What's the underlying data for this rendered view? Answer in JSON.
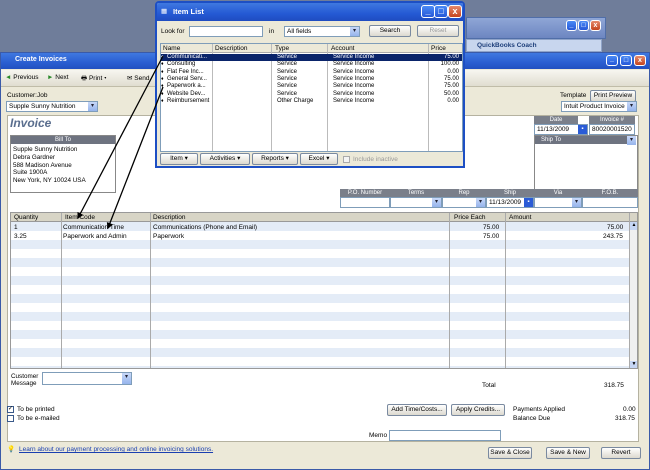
{
  "coach": {
    "title": "QuickBooks Coach"
  },
  "invoice_window": {
    "title": "Create Invoices",
    "toolbar": [
      "Previous",
      "Next",
      "Print",
      "Send"
    ],
    "customer_label": "Customer:Job",
    "customer_value": "Supple Sunny Nutrition",
    "template_label": "Template",
    "print_preview": "Print Preview",
    "template_value": "Intuit Product Invoice",
    "heading": "Invoice",
    "date_label": "Date",
    "date_value": "11/13/2009",
    "invoice_no_label": "Invoice #",
    "invoice_no_value": "80020001520",
    "bill_to_label": "Bill To",
    "bill_to_lines": [
      "Supple Sunny Nutrition",
      "Debra Gardner",
      "588 Madison Avenue",
      "Suite 1900A",
      "New York, NY 10024 USA"
    ],
    "ship_to_label": "Ship To",
    "fields": {
      "po": "P.O. Number",
      "terms": "Terms",
      "rep": "Rep",
      "ship": "Ship",
      "ship_value": "11/13/2009",
      "via": "Via",
      "fob": "F.O.B."
    },
    "columns": {
      "qty": "Quantity",
      "code": "Item Code",
      "desc": "Description",
      "price": "Price Each",
      "amount": "Amount"
    },
    "rows": [
      {
        "qty": "1",
        "code": "Communication Time",
        "desc": "Communications (Phone and Email)",
        "price": "75.00",
        "amount": "75.00"
      },
      {
        "qty": "3.25",
        "code": "Paperwork and Admin",
        "desc": "Paperwork",
        "price": "75.00",
        "amount": "243.75"
      }
    ],
    "customer_message_label": "Customer Message",
    "total_label": "Total",
    "total_value": "318.75",
    "to_be_printed": "To be printed",
    "to_be_emailed": "To be e-mailed",
    "add_time": "Add Time/Costs...",
    "apply_credits": "Apply Credits...",
    "payments_applied_label": "Payments Applied",
    "payments_applied_value": "0.00",
    "balance_due_label": "Balance Due",
    "balance_due_value": "318.75",
    "learn_link": "Learn about our payment processing and online invoicing solutions.",
    "memo_label": "Memo",
    "save_close": "Save & Close",
    "save_new": "Save & New",
    "revert": "Revert"
  },
  "item_list": {
    "title": "Item List",
    "look_for": "Look for",
    "in_label": "in",
    "in_value": "All fields",
    "search": "Search",
    "reset": "Reset",
    "columns": [
      "Name",
      "Description",
      "Type",
      "Account",
      "Price"
    ],
    "rows": [
      {
        "name": "Communicati...",
        "type": "Service",
        "account": "Service Income",
        "price": "75.00"
      },
      {
        "name": "Consulting",
        "type": "Service",
        "account": "Service Income",
        "price": "100.00"
      },
      {
        "name": "Flat Fee Inc...",
        "type": "Service",
        "account": "Service Income",
        "price": "0.00"
      },
      {
        "name": "General Serv...",
        "type": "Service",
        "account": "Service Income",
        "price": "75.00"
      },
      {
        "name": "Paperwork a...",
        "type": "Service",
        "account": "Service Income",
        "price": "75.00"
      },
      {
        "name": "Website Dev...",
        "type": "Service",
        "account": "Service Income",
        "price": "50.00"
      },
      {
        "name": "Reimbursement",
        "type": "Other Charge",
        "account": "Service Income",
        "price": "0.00"
      }
    ],
    "footer": [
      "Item",
      "Activities",
      "Reports",
      "Excel"
    ],
    "include_inactive": "Include inactive"
  }
}
